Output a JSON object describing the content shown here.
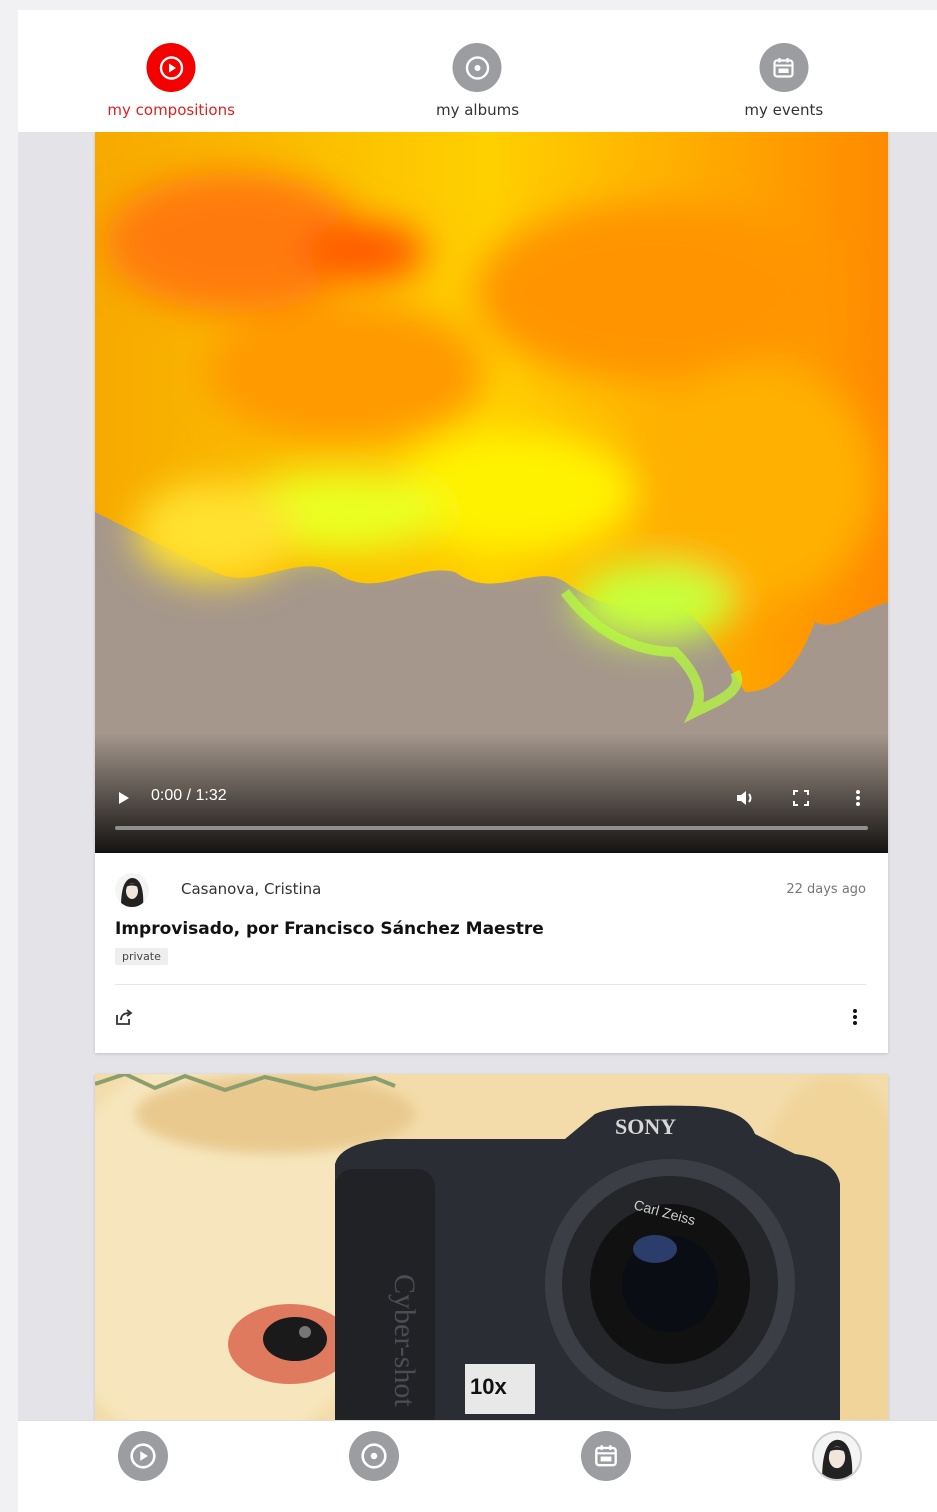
{
  "tabs": [
    {
      "label": "my compositions",
      "icon": "play-circle-icon",
      "active": true
    },
    {
      "label": "my albums",
      "icon": "disc-icon",
      "active": false
    },
    {
      "label": "my events",
      "icon": "calendar-icon",
      "active": false
    }
  ],
  "video_card": {
    "player": {
      "time": "0:00 / 1:32"
    },
    "author": "Casanova, Cristina",
    "ago": "22 days ago",
    "title": "Improvisado, por Francisco Sánchez Maestre",
    "badge": "private"
  },
  "second_card": {
    "image": "camera-photo"
  },
  "bottom_nav": [
    {
      "icon": "play-circle-icon"
    },
    {
      "icon": "disc-icon"
    },
    {
      "icon": "calendar-icon"
    },
    {
      "icon": "profile-avatar"
    }
  ],
  "colors": {
    "accent": "#f40000",
    "icon_gray": "#9c9da1",
    "background": "#e3e3e8"
  }
}
